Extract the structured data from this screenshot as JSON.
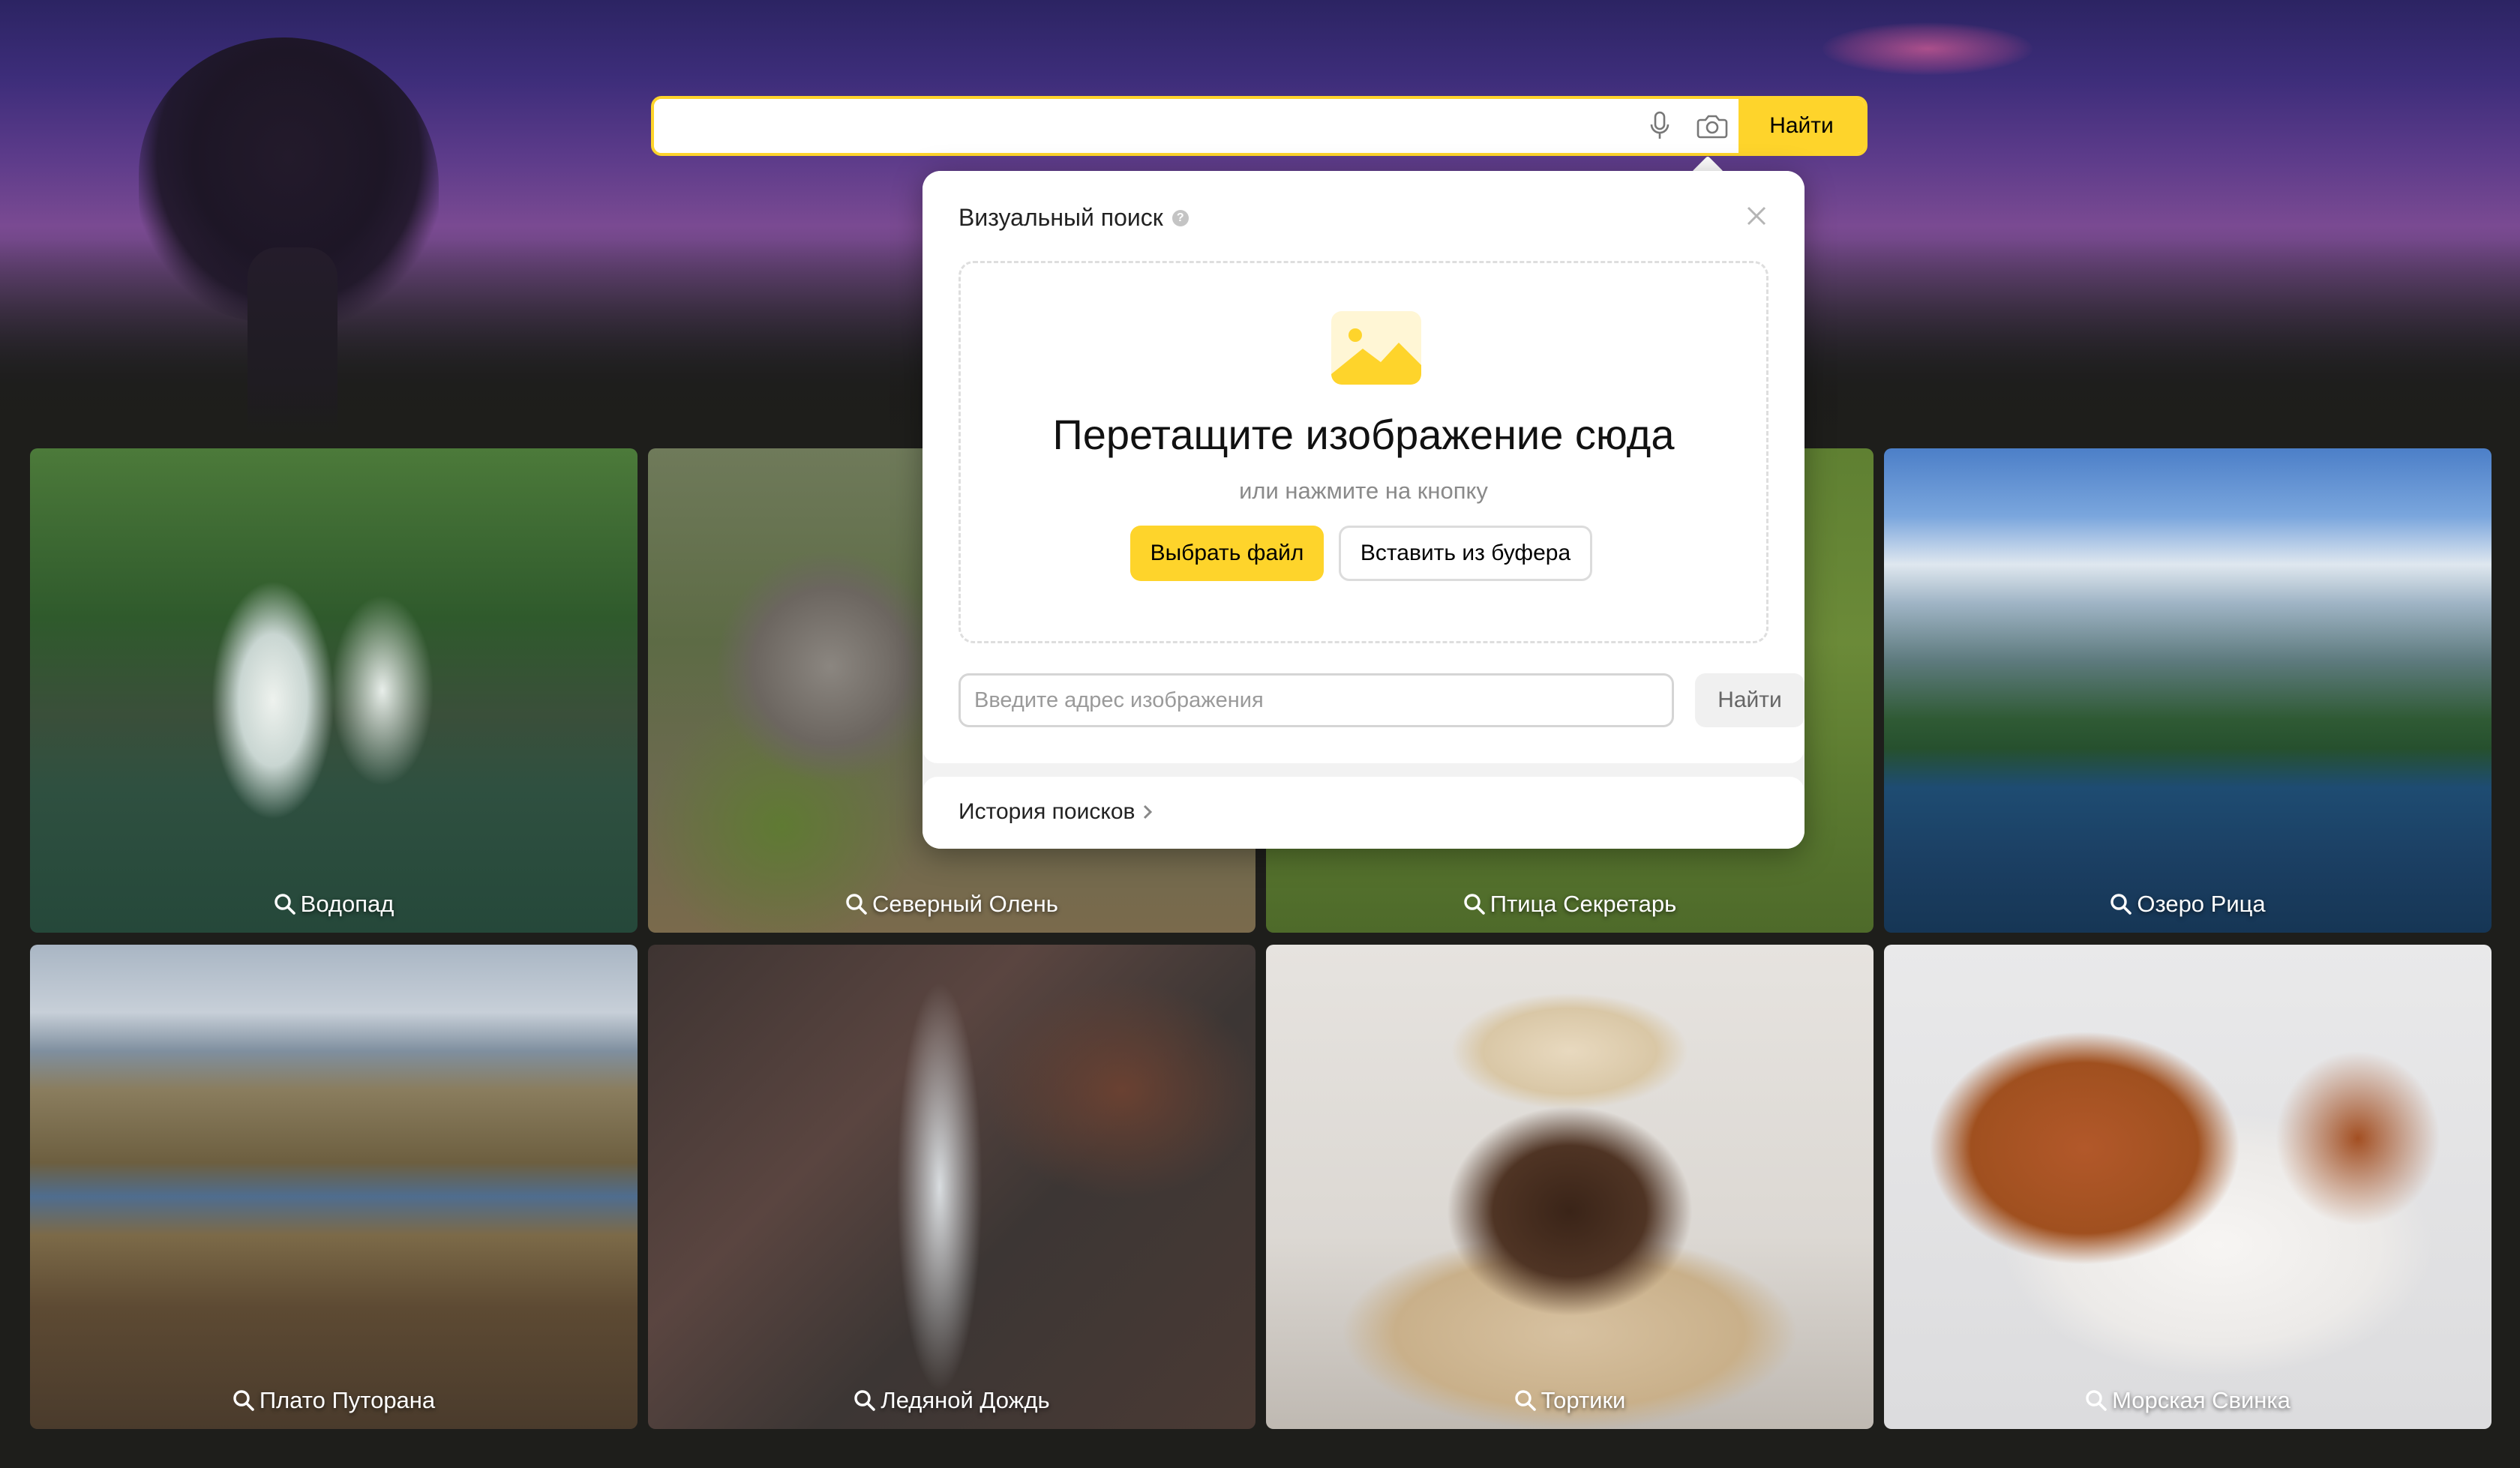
{
  "search": {
    "value": "",
    "find_label": "Найти",
    "mic_icon": "microphone-icon",
    "camera_icon": "camera-search-icon"
  },
  "popup": {
    "title": "Визуальный поиск",
    "help_icon": "?",
    "dropzone": {
      "title": "Перетащите изображение сюда",
      "subtitle": "или нажмите на кнопку",
      "choose_label": "Выбрать файл",
      "paste_label": "Вставить из буфера"
    },
    "url_placeholder": "Введите адрес изображения",
    "url_find_label": "Найти",
    "history_label": "История поисков"
  },
  "tiles": [
    {
      "label": "Водопад"
    },
    {
      "label": "Северный Олень"
    },
    {
      "label": "Птица Секретарь"
    },
    {
      "label": "Озеро Рица"
    },
    {
      "label": "Плато Путорана"
    },
    {
      "label": "Ледяной Дождь"
    },
    {
      "label": "Тортики"
    },
    {
      "label": "Морская Свинка"
    }
  ],
  "colors": {
    "accent": "#fed42b",
    "page_bg": "#1e1e1b"
  }
}
